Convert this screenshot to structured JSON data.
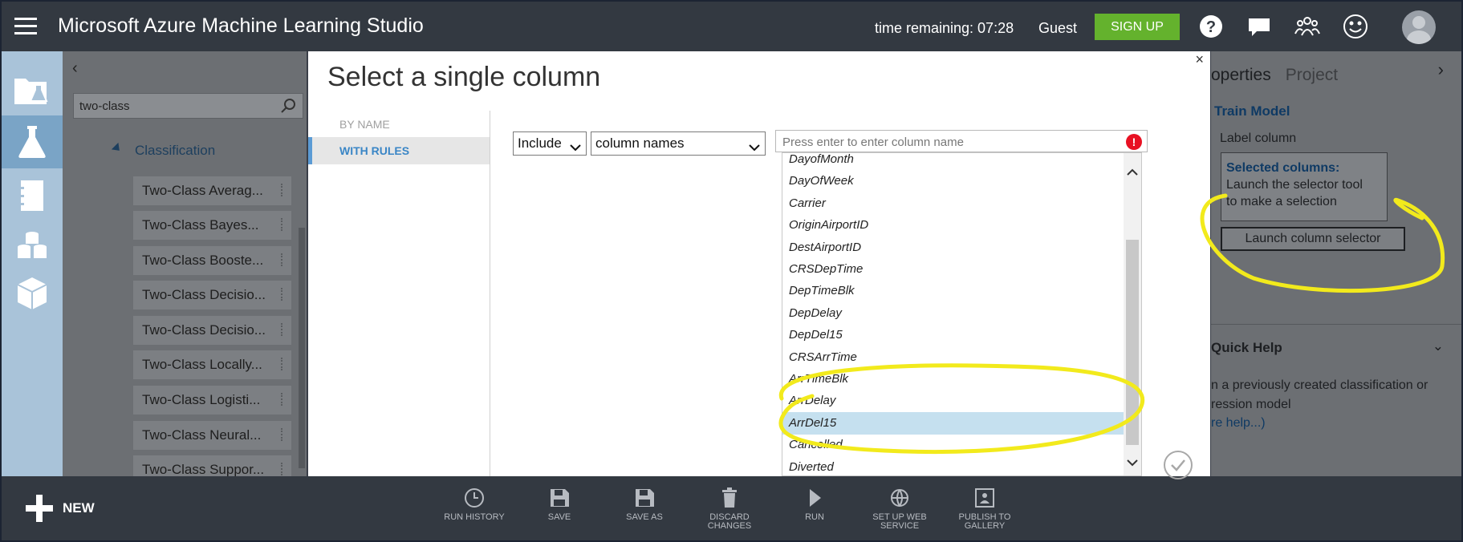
{
  "header": {
    "app_title": "Microsoft Azure Machine Learning Studio",
    "time_remaining": "time remaining: 07:28",
    "user": "Guest",
    "signup_label": "SIGN UP",
    "icons": [
      "help-icon",
      "feedback-icon",
      "community-icon",
      "smiley-icon",
      "avatar"
    ]
  },
  "rail": {
    "items": [
      "projects-icon",
      "experiments-icon",
      "notebooks-icon",
      "datasets-icon",
      "models-icon"
    ],
    "active_index": 1
  },
  "palette": {
    "search_value": "two-class",
    "category": "Classification",
    "items": [
      "Two-Class Averag...",
      "Two-Class Bayes...",
      "Two-Class Booste...",
      "Two-Class Decisio...",
      "Two-Class Decisio...",
      "Two-Class Locally...",
      "Two-Class Logisti...",
      "Two-Class Neural...",
      "Two-Class Suppor..."
    ]
  },
  "dialog": {
    "title": "Select a single column",
    "close": "×",
    "nav": {
      "by_name": "BY NAME",
      "with_rules": "WITH RULES"
    },
    "include_value": "Include",
    "type_value": "column names",
    "input_placeholder": "Press enter to enter column name",
    "error_mark": "!",
    "columns": [
      "DayofMonth",
      "DayOfWeek",
      "Carrier",
      "OriginAirportID",
      "DestAirportID",
      "CRSDepTime",
      "DepTimeBlk",
      "DepDelay",
      "DepDel15",
      "CRSArrTime",
      "ArrTimeBlk",
      "ArrDelay",
      "ArrDel15",
      "Cancelled",
      "Diverted"
    ],
    "selected_column": "ArrDel15"
  },
  "properties": {
    "tab_properties": "operties",
    "tab_project": "Project",
    "module_name": "Train Model",
    "label_column": "Label column",
    "selected_title": "Selected columns:",
    "selected_line1": "Launch the selector tool",
    "selected_line2": "to make a selection",
    "launch_button": "Launch column selector",
    "quick_help": "Quick Help",
    "help_line1": "n a previously created classification or",
    "help_line2": "ression model",
    "help_link": "re help...)"
  },
  "toolbar": {
    "new_label": "NEW",
    "items": [
      {
        "label": "RUN HISTORY",
        "icon": "clock-icon"
      },
      {
        "label": "SAVE",
        "icon": "save-icon"
      },
      {
        "label": "SAVE AS",
        "icon": "save-as-icon"
      },
      {
        "label": "DISCARD CHANGES",
        "icon": "trash-icon"
      },
      {
        "label": "RUN",
        "icon": "play-icon"
      },
      {
        "label": "SET UP WEB SERVICE",
        "icon": "web-service-icon"
      },
      {
        "label": "PUBLISH TO GALLERY",
        "icon": "gallery-icon"
      }
    ]
  },
  "colors": {
    "topbar": "#333941",
    "signup": "#64b22d",
    "rail": "#a9c3d9",
    "accent": "#3a86c6",
    "selection": "#c5e0ef",
    "annotation": "#f2ea1c"
  }
}
